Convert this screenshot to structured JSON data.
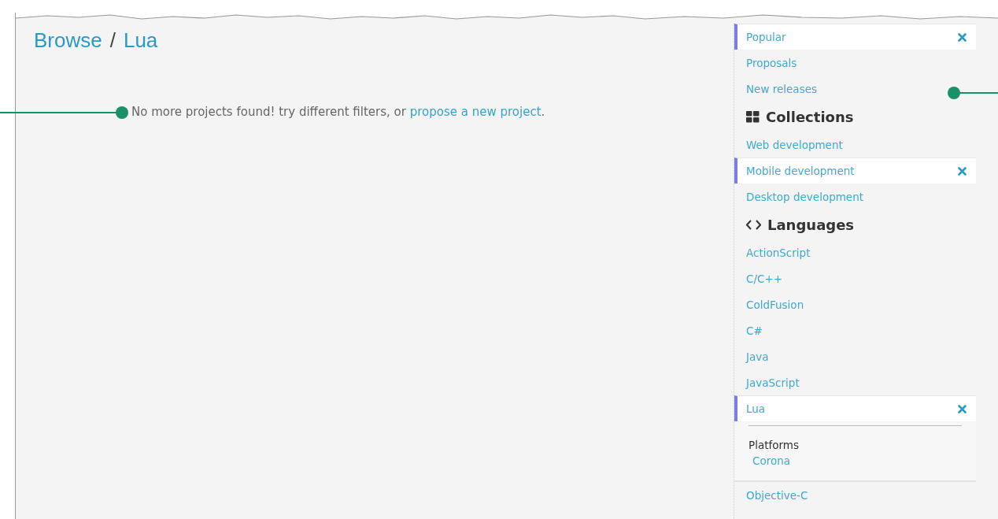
{
  "breadcrumb": {
    "items": [
      {
        "label": "Browse"
      },
      {
        "label": "Lua"
      }
    ],
    "separator": "/"
  },
  "message": {
    "text": "No more projects found! try different filters, or ",
    "link": "propose a new project",
    "after": "."
  },
  "sidebar": {
    "groups": [
      {
        "items": [
          {
            "label": "Popular",
            "selected": true
          },
          {
            "label": "Proposals",
            "selected": false
          },
          {
            "label": "New releases",
            "selected": false
          }
        ]
      },
      {
        "heading": "Collections",
        "kind": "grid",
        "items": [
          {
            "label": "Web development",
            "selected": false
          },
          {
            "label": "Mobile development",
            "selected": true
          },
          {
            "label": "Desktop development",
            "selected": false
          }
        ]
      },
      {
        "heading": "Languages",
        "kind": "code",
        "items": [
          {
            "label": "ActionScript",
            "selected": false
          },
          {
            "label": "C/C++",
            "selected": false
          },
          {
            "label": "ColdFusion",
            "selected": false
          },
          {
            "label": "C#",
            "selected": false
          },
          {
            "label": "Java",
            "selected": false
          },
          {
            "label": "JavaScript",
            "selected": false
          },
          {
            "label": "Lua",
            "selected": true,
            "filters": {
              "title": "Platforms",
              "options": [
                {
                  "label": "Corona"
                }
              ]
            }
          },
          {
            "label": "Objective-C",
            "selected": false
          }
        ]
      }
    ]
  }
}
